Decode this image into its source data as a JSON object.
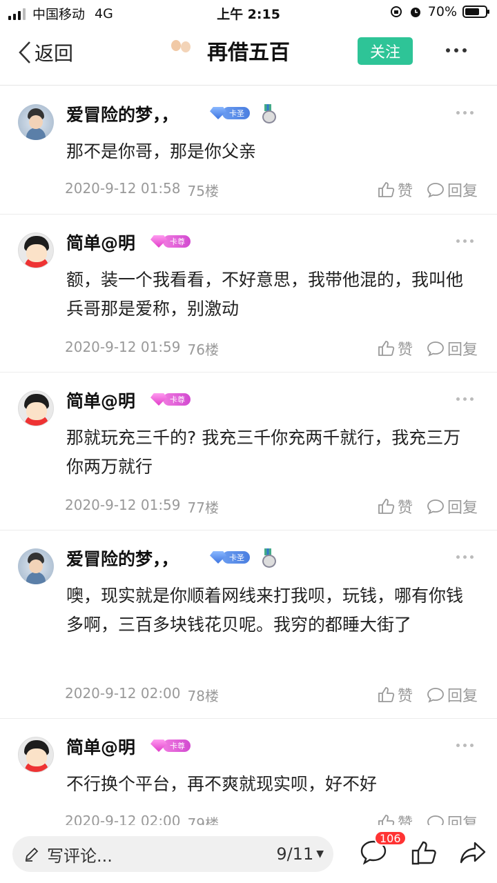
{
  "status_bar": {
    "carrier": "中国移动",
    "network": "4G",
    "time": "上午 2:15",
    "battery": "70%",
    "battery_level": 0.7
  },
  "nav": {
    "back_label": "返回",
    "title": "再借五百",
    "follow_label": "关注"
  },
  "posts": [
    {
      "user": "爱冒险的梦，，",
      "badge_text": "卡圣",
      "content": "那不是你哥，那是你父亲",
      "time": "2020-9-12 01:58",
      "floor": "75楼"
    },
    {
      "user": "简单@明",
      "badge_text": "卡尊",
      "content": "额，装一个我看看，不好意思，我带他混的，我叫他兵哥那是爱称，别激动",
      "time": "2020-9-12 01:59",
      "floor": "76楼"
    },
    {
      "user": "简单@明",
      "badge_text": "卡尊",
      "content": "那就玩充三千的? 我充三千你充两千就行，我充三万你两万就行",
      "time": "2020-9-12 01:59",
      "floor": "77楼"
    },
    {
      "user": "爱冒险的梦，，",
      "badge_text": "卡圣",
      "content": "噢，现实就是你顺着网线来打我呗，玩钱，哪有你钱多啊，三百多块钱花贝呢。我穷的都睡大街了",
      "time": "2020-9-12 02:00",
      "floor": "78楼"
    },
    {
      "user": "简单@明",
      "badge_text": "卡尊",
      "content": "不行换个平台，再不爽就现实呗，好不好",
      "time": "2020-9-12 02:00",
      "floor": "79楼"
    }
  ],
  "actions": {
    "like_label": "赞",
    "reply_label": "回复"
  },
  "bottom_bar": {
    "comment_placeholder": "写评论...",
    "page_indicator": "9/11",
    "comment_count": "106"
  },
  "colors": {
    "follow_green": "#2ec497",
    "badge_blue": "#4a7ee0",
    "badge_pink": "#d24ad0",
    "count_red": "#ff3333"
  },
  "icons": [
    "back-chevron-icon",
    "more-dots-icon",
    "thumbs-up-icon",
    "reply-bubble-icon",
    "pencil-icon",
    "comment-icon",
    "like-icon",
    "share-icon"
  ]
}
